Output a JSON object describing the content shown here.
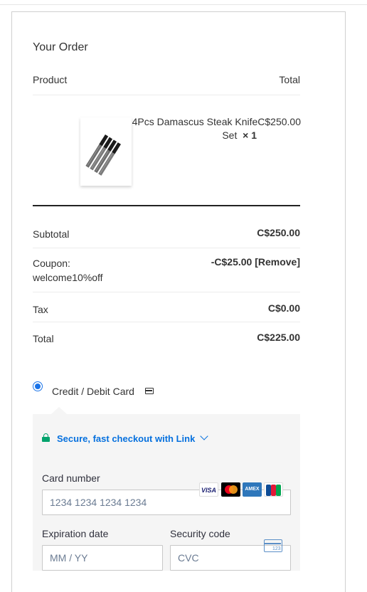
{
  "order": {
    "title": "Your Order",
    "col_product": "Product",
    "col_total": "Total"
  },
  "item": {
    "name": "4Pcs Damascus Steak KnifeC$250.00",
    "name_line2": "Set",
    "qty": "× 1",
    "image_alt": "knife-set-image"
  },
  "totals": {
    "subtotal_label": "Subtotal",
    "subtotal_value": "C$250.00",
    "coupon_label": "Coupon: welcome10%off",
    "coupon_value": "-C$25.00 [Remove]",
    "tax_label": "Tax",
    "tax_value": "C$0.00",
    "total_label": "Total",
    "total_value": "C$225.00"
  },
  "payment": {
    "method_label": "Credit / Debit Card",
    "link_text": "Secure, fast checkout with Link",
    "card_number_label": "Card number",
    "card_number_placeholder": "1234 1234 1234 1234",
    "expiry_label": "Expiration date",
    "expiry_placeholder": "MM / YY",
    "cvc_label": "Security code",
    "cvc_placeholder": "CVC",
    "cvc_icon_text": "123",
    "brands": [
      "VISA",
      "mastercard",
      "AMEX",
      "JCB"
    ]
  },
  "colors": {
    "accent_link": "#0570de",
    "lock_green": "#00a36c",
    "radio_blue": "#1a73e8"
  }
}
